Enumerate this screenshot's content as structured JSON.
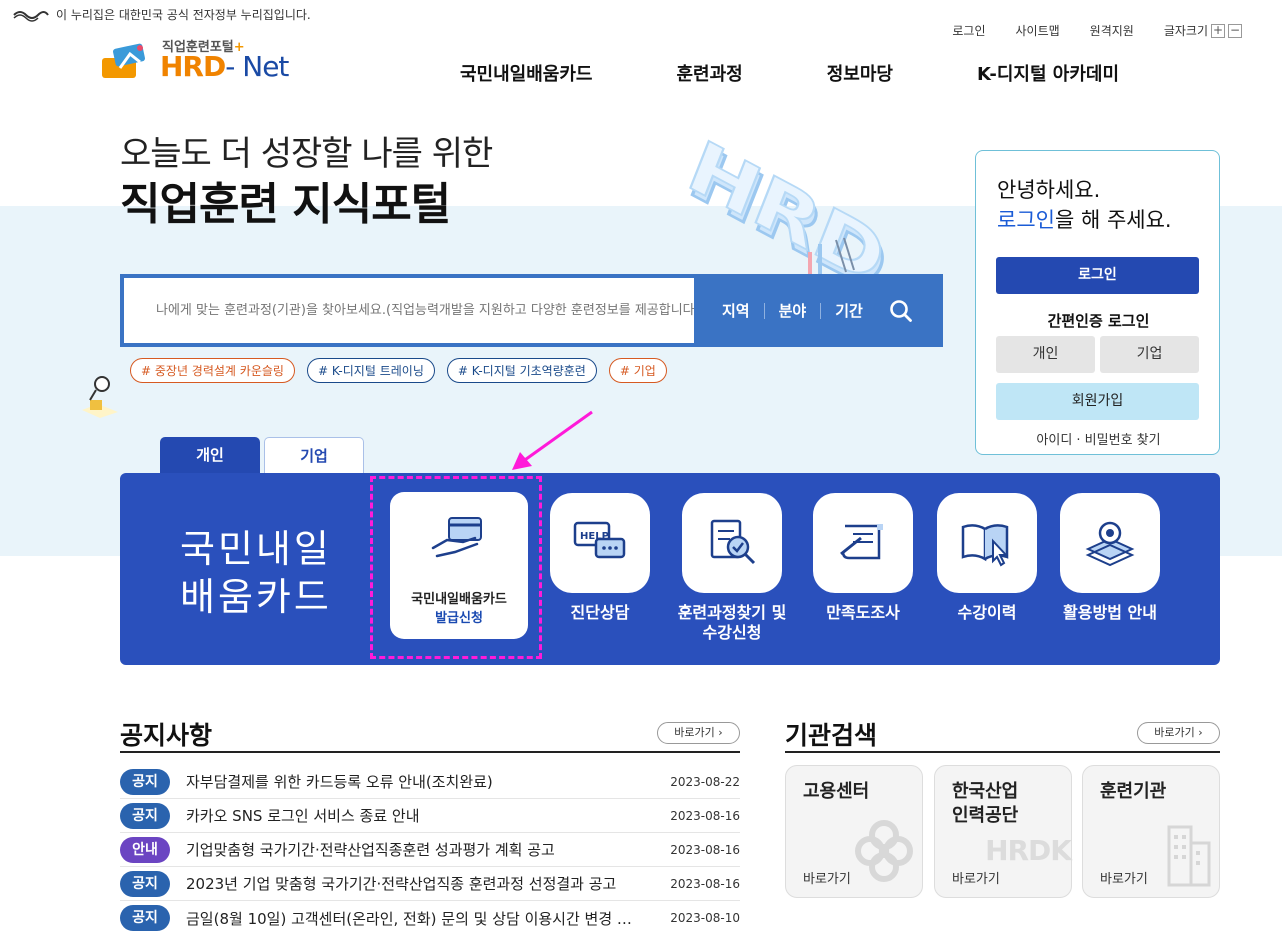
{
  "gov_banner": {
    "text": "이 누리집은 대한민국 공식 전자정부 누리집입니다."
  },
  "utility": {
    "login": "로그인",
    "sitemap": "사이트맵",
    "remote": "원격지원",
    "font_size": "글자크기",
    "plus": "+",
    "minus": "−"
  },
  "logo": {
    "sub": "직업훈련포털",
    "sub_mark": "+",
    "main_a": "HRD",
    "main_b": "- Net"
  },
  "gnb": [
    "국민내일배움카드",
    "훈련과정",
    "정보마당",
    "K-디지털 아카데미"
  ],
  "hero": {
    "line1": "오늘도 더 성장할 나를 위한",
    "line2": "직업훈련 지식포털"
  },
  "search": {
    "placeholder": "나에게 맞는 훈련과정(기관)을 찾아보세요.(직업능력개발을 지원하고 다양한 훈련정보를 제공합니다.)",
    "filters": [
      "지역",
      "분야",
      "기간"
    ]
  },
  "tags": [
    {
      "label": "# 중장년 경력설계 카운슬링",
      "color": "orange"
    },
    {
      "label": "# K-디지털 트레이닝",
      "color": "blue"
    },
    {
      "label": "# K-디지털 기초역량훈련",
      "color": "blue"
    },
    {
      "label": "# 기업",
      "color": "orange"
    }
  ],
  "login_box": {
    "greeting": "안녕하세요.",
    "prompt_link": "로그인",
    "prompt_rest": "을 해 주세요.",
    "login_button": "로그인",
    "easy_login": "간편인증 로그인",
    "personal": "개인",
    "company": "기업",
    "join": "회원가입",
    "find": "아이디 · 비밀번호 찾기"
  },
  "tabs": [
    "개인",
    "기업"
  ],
  "card_panel": {
    "title_line1": "국민내일",
    "title_line2": "배움카드",
    "featured": {
      "line1": "국민내일배움카드",
      "line2": "발급신청"
    },
    "services": [
      {
        "label": "진단상담",
        "icon": "help-chat-icon"
      },
      {
        "label": "훈련과정찾기 및\n수강신청",
        "icon": "document-search-icon"
      },
      {
        "label": "만족도조사",
        "icon": "survey-pen-icon"
      },
      {
        "label": "수강이력",
        "icon": "book-cursor-icon"
      },
      {
        "label": "활용방법 안내",
        "icon": "gear-stack-icon"
      }
    ]
  },
  "notice": {
    "title": "공지사항",
    "more": "바로가기",
    "items": [
      {
        "badge": "공지",
        "title": "자부담결제를 위한 카드등록 오류 안내(조치완료)",
        "date": "2023-08-22"
      },
      {
        "badge": "공지",
        "title": "카카오 SNS 로그인 서비스 종료 안내",
        "date": "2023-08-16"
      },
      {
        "badge": "안내",
        "title": "기업맞춤형 국가기간·전략산업직종훈련 성과평가 계획 공고",
        "date": "2023-08-16"
      },
      {
        "badge": "공지",
        "title": "2023년 기업 맞춤형 국가기간·전략산업직종 훈련과정 선정결과 공고",
        "date": "2023-08-16"
      },
      {
        "badge": "공지",
        "title": "금일(8월 10일) 고객센터(온라인, 전화) 문의 및 상담 이용시간 변경 …",
        "date": "2023-08-10"
      }
    ]
  },
  "org_search": {
    "title": "기관검색",
    "more": "바로가기",
    "items": [
      {
        "name": "고용센터",
        "go": "바로가기"
      },
      {
        "name": "한국산업\n인력공단",
        "go": "바로가기",
        "watermark": "HRDK"
      },
      {
        "name": "훈련기관",
        "go": "바로가기"
      }
    ]
  }
}
